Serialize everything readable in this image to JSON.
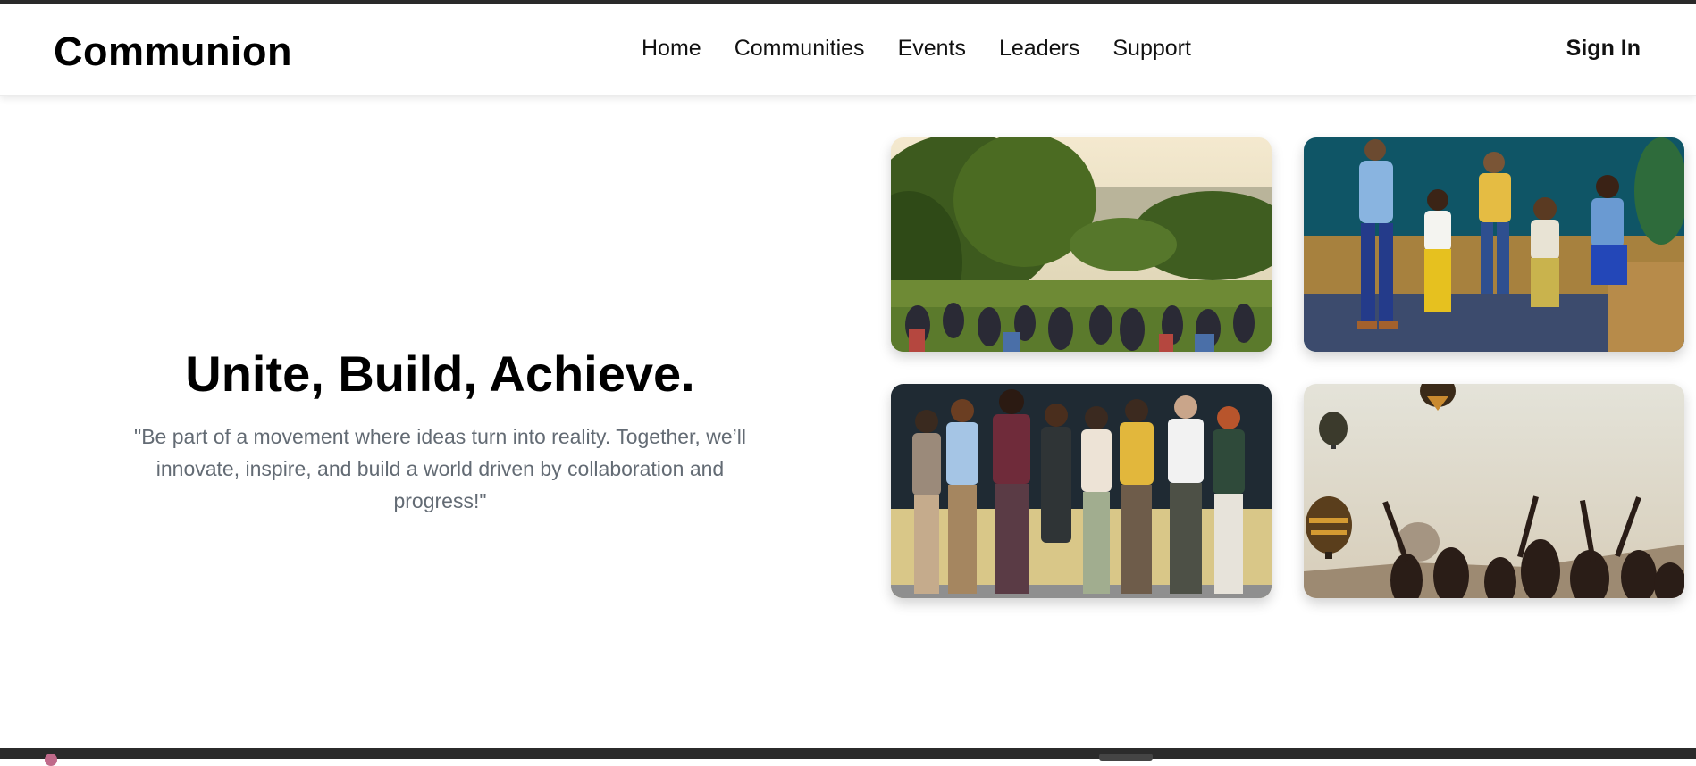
{
  "header": {
    "brand": "Communion",
    "nav": [
      {
        "label": "Home"
      },
      {
        "label": "Communities"
      },
      {
        "label": "Events"
      },
      {
        "label": "Leaders"
      },
      {
        "label": "Support"
      }
    ],
    "signin_label": "Sign In"
  },
  "hero": {
    "title": "Unite, Build, Achieve.",
    "quote": "\"Be part of a movement where ideas turn into reality. Together, we’ll innovate, inspire, and build a world driven by collaboration and progress!\""
  },
  "gallery": [
    {
      "subject": "crowd-in-park-photo"
    },
    {
      "subject": "group-conversation-photo"
    },
    {
      "subject": "people-embracing-photo"
    },
    {
      "subject": "hot-air-balloons-photo"
    }
  ],
  "colors": {
    "text_primary": "#000000",
    "text_muted": "#636b74",
    "background": "#ffffff"
  }
}
